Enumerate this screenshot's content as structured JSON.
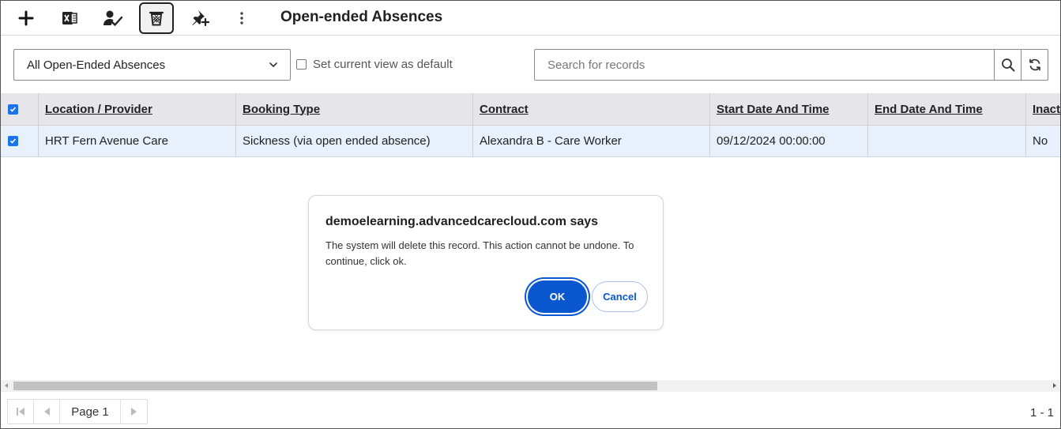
{
  "toolbar": {
    "buttons": [
      {
        "icon": "plus-icon"
      },
      {
        "icon": "excel-export-icon"
      },
      {
        "icon": "user-check-icon"
      },
      {
        "icon": "delete-bin-icon",
        "active": true
      },
      {
        "icon": "pin-add-icon"
      },
      {
        "icon": "more-vertical-icon"
      }
    ],
    "title": "Open-ended Absences"
  },
  "view": {
    "selected": "All Open-Ended Absences",
    "default_label": "Set current view as default",
    "default_checked": false
  },
  "search": {
    "placeholder": "Search for records"
  },
  "grid": {
    "header_checked": true,
    "columns": [
      "Location / Provider",
      "Booking Type",
      "Contract",
      "Start Date And Time",
      "End Date And Time",
      "Inactive"
    ],
    "rows": [
      {
        "checked": true,
        "cells": [
          "HRT Fern Avenue Care",
          "Sickness (via open ended absence)",
          "Alexandra B - Care Worker",
          "09/12/2024 00:00:00",
          "",
          "No"
        ]
      }
    ]
  },
  "pager": {
    "page_label": "Page 1",
    "count": "1 - 1"
  },
  "dialog": {
    "title": "demoelearning.advancedcarecloud.com says",
    "message": "The system will delete this record. This action cannot be undone. To continue, click ok.",
    "ok_label": "OK",
    "cancel_label": "Cancel"
  },
  "colors": {
    "accent": "#0b57d0",
    "checkbox": "#1a73e8",
    "header_bg": "#e6e6ea",
    "selected_row_bg": "#e8f1fb"
  }
}
